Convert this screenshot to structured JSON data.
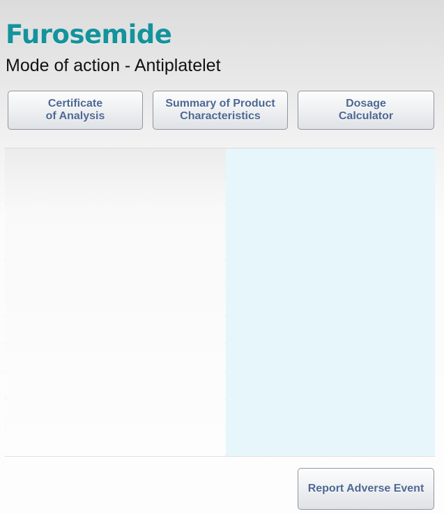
{
  "header": {
    "title": "Furosemide",
    "subtitle": "Mode of action - Antiplatelet"
  },
  "buttons": {
    "certificate": {
      "line1": "Certificate",
      "line2": "of Analysis"
    },
    "summary": {
      "line1": "Summary of Product",
      "line2": "Characteristics"
    },
    "dosage": {
      "line1": "Dosage",
      "line2": "Calculator"
    },
    "report": {
      "label": "Report Adverse Event"
    }
  },
  "colors": {
    "title": "#14939c",
    "button_text": "#4d6894",
    "panel_right": "#e6f6fb"
  }
}
